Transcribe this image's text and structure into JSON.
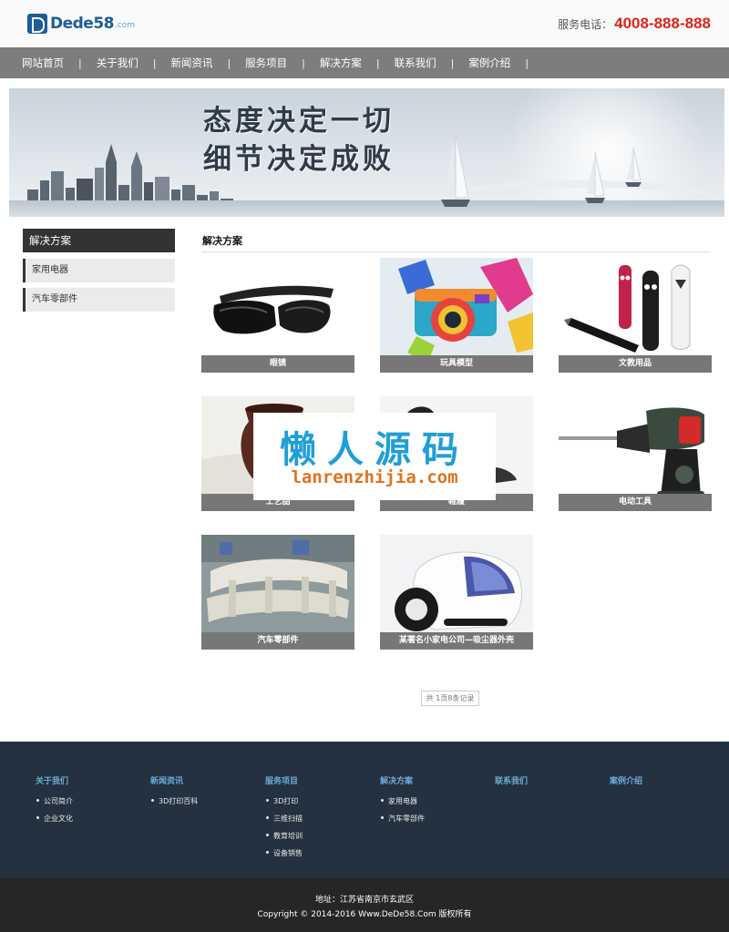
{
  "header": {
    "logo_text": "Dede58",
    "logo_domain": ".com",
    "phone_label": "服务电话：",
    "phone_number": "4008-888-888"
  },
  "nav": {
    "items": [
      "网站首页",
      "关于我们",
      "新闻资讯",
      "服务项目",
      "解决方案",
      "联系我们",
      "案例介绍"
    ]
  },
  "banner": {
    "line1": "态度决定一切",
    "line2": "细节决定成败"
  },
  "sidebar": {
    "title": "解决方案",
    "items": [
      "家用电器",
      "汽车零部件"
    ]
  },
  "content": {
    "title": "解决方案",
    "products": [
      {
        "caption": "眼镜",
        "icon": "vr-glasses-icon"
      },
      {
        "caption": "玩具模型",
        "icon": "toy-camera-icon"
      },
      {
        "caption": "文教用品",
        "icon": "stationery-icon"
      },
      {
        "caption": "工艺品",
        "icon": "craft-vase-icon"
      },
      {
        "caption": "鞋履",
        "icon": "shoe-icon"
      },
      {
        "caption": "电动工具",
        "icon": "power-drill-icon"
      },
      {
        "caption": "汽车零部件",
        "icon": "auto-parts-icon"
      },
      {
        "caption": "某著名小家电公司—吸尘器外壳",
        "icon": "vacuum-cleaner-icon"
      }
    ],
    "pager": "共 1页8条记录"
  },
  "watermark": {
    "cn": "懒人源码",
    "en": "lanrenzhijia.com"
  },
  "footer": {
    "columns": [
      {
        "title": "关于我们",
        "links": [
          "公司简介",
          "企业文化"
        ]
      },
      {
        "title": "新闻资讯",
        "links": [
          "3D打印百科"
        ]
      },
      {
        "title": "服务项目",
        "links": [
          "3D打印",
          "三维扫描",
          "教育培训",
          "设备销售"
        ]
      },
      {
        "title": "解决方案",
        "links": [
          "家用电器",
          "汽车零部件"
        ]
      },
      {
        "title": "联系我们",
        "links": []
      },
      {
        "title": "案例介绍",
        "links": []
      }
    ],
    "address": "地址：江苏省南京市玄武区",
    "copyright": "Copyright © 2014-2016 Www.DeDe58.Com 版权所有"
  },
  "colors": {
    "nav_bg": "#7d7d7d",
    "phone": "#d9261c",
    "footer_bg": "#233140",
    "footer_title": "#6ea9d8",
    "bottom_bg": "#262626",
    "watermark_cn": "#1e9fd9",
    "watermark_en": "#e0731e"
  }
}
